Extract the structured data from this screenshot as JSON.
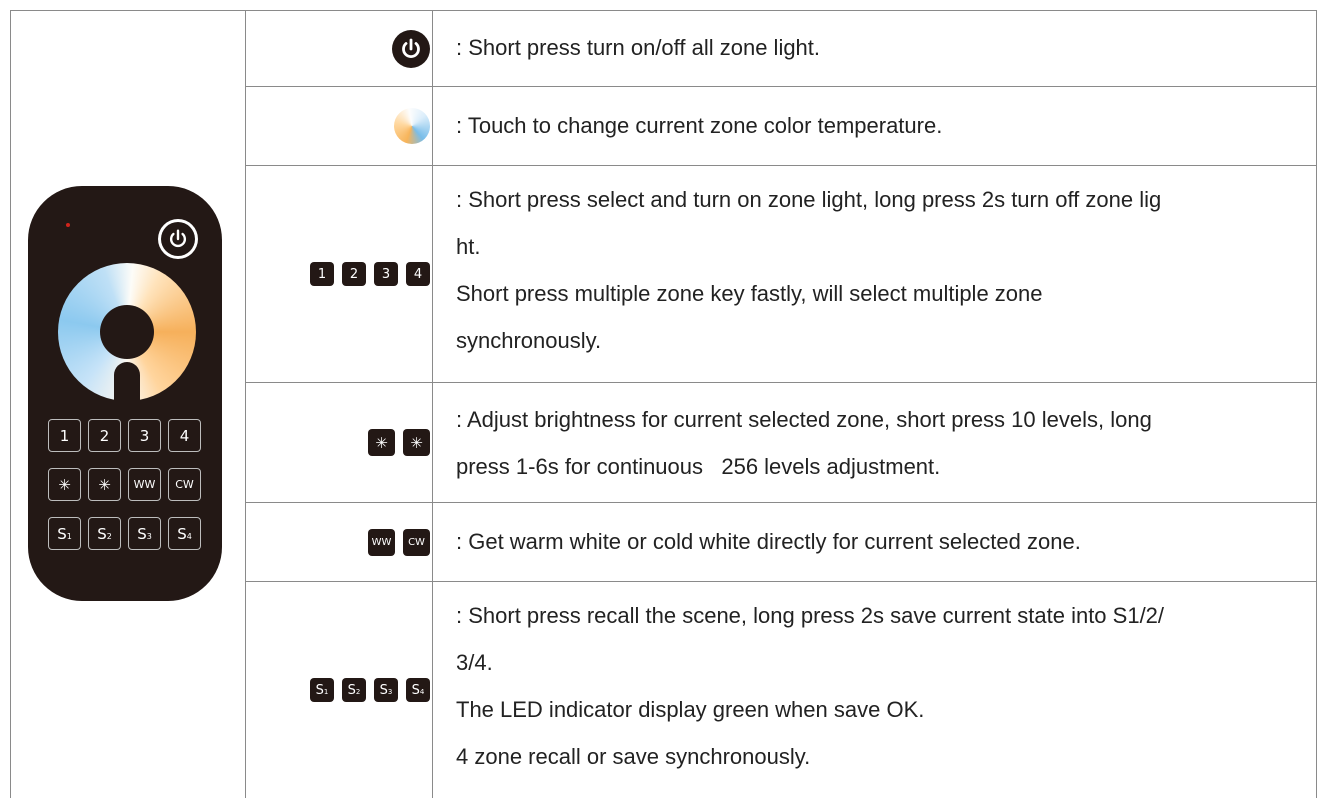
{
  "rows": [
    {
      "icon": "power-icon",
      "lines": [
        ": Short press turn on/off all zone light."
      ]
    },
    {
      "icon": "color-temperature-wheel-icon",
      "lines": [
        ": Touch to change current zone color temperature."
      ]
    },
    {
      "icon_keys": [
        "1",
        "2",
        "3",
        "4"
      ],
      "lines": [
        ": Short press select and turn on zone light, long press 2s turn off zone lig",
        "ht.",
        "Short press multiple zone key fastly, will select multiple zone",
        "synchronously."
      ]
    },
    {
      "icon_keys": [
        "brightness-down-icon",
        "brightness-up-icon"
      ],
      "lines": [
        ": Adjust brightness for current selected zone, short press 10 levels, long",
        "press 1-6s for continuous   256 levels adjustment."
      ]
    },
    {
      "icon_keys": [
        "WW",
        "CW"
      ],
      "lines": [
        ": Get warm white or cold white directly for current selected zone."
      ]
    },
    {
      "icon_keys": [
        "S1",
        "S2",
        "S3",
        "S4"
      ],
      "lines": [
        ": Short press recall the scene, long press 2s save current state into S1/2/",
        "3/4.",
        "The LED indicator display green when save OK.",
        "4 zone recall or save synchronously."
      ]
    }
  ],
  "remote": {
    "zone_keys": [
      "1",
      "2",
      "3",
      "4"
    ],
    "function_keys": [
      "brightness-down-icon",
      "brightness-up-icon",
      "WW",
      "CW"
    ],
    "scene_keys": [
      "S",
      "S",
      "S",
      "S"
    ],
    "scene_subs": [
      "1",
      "2",
      "3",
      "4"
    ]
  },
  "colors": {
    "key_bg": "#231815",
    "led": "#d0241b",
    "border": "#8a8a8a"
  }
}
